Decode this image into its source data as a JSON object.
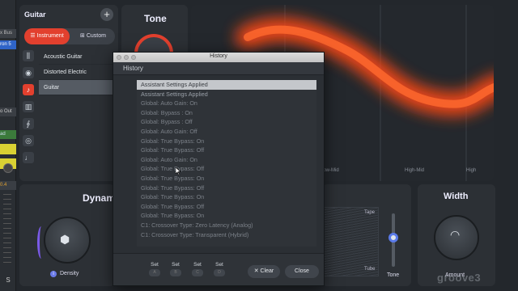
{
  "host": {
    "tags": [
      "x Bus",
      "ron 5",
      "o Out",
      "ad",
      "0.4",
      "S"
    ]
  },
  "browser": {
    "title": "Guitar",
    "add_label": "+",
    "tabs": {
      "instrument": "Instrument",
      "custom": "Custom"
    },
    "items": [
      {
        "label": "Acoustic Guitar"
      },
      {
        "label": "Distorted Electric"
      },
      {
        "label": "Guitar",
        "selected": true
      }
    ],
    "category_icons": [
      "mixer-icon",
      "speaker-icon",
      "guitar-icon",
      "piano-icon",
      "strings-icon",
      "drum-icon",
      "bass-icon"
    ]
  },
  "tone": {
    "title": "Tone"
  },
  "spectrum": {
    "bands": [
      "Low-Mid",
      "High-Mid",
      "High"
    ],
    "curve_color": "#ff4a12"
  },
  "dynamics": {
    "title": "Dynam",
    "knob_label": "Density"
  },
  "tape_tube": {
    "tape_label": "Tape",
    "tube_label": "Tube",
    "slider_label": "Tone"
  },
  "width": {
    "title": "Width",
    "knob_label": "Amount"
  },
  "watermark": "groove3",
  "history": {
    "window_title": "History",
    "header": "History",
    "items": [
      "Assistant Settings Applied",
      "Assistant Settings Applied",
      "Global: Auto Gain: On",
      "Global: Bypass : On",
      "Global: Bypass : Off",
      "Global: Auto Gain: Off",
      "Global: True Bypass: On",
      "Global: True Bypass: Off",
      "Global: Auto Gain: On",
      "Global: True Bypass: Off",
      "Global: True Bypass: On",
      "Global: True Bypass: Off",
      "Global: True Bypass: On",
      "Global: True Bypass: Off",
      "Global: True Bypass: On",
      "C1: Crossover Type: Zero Latency (Analog)",
      "C1: Crossover Type: Transparent (Hybrid)"
    ],
    "selected_index": 0,
    "set_buttons": [
      {
        "label": "Set",
        "slot": "A"
      },
      {
        "label": "Set",
        "slot": "B"
      },
      {
        "label": "Set",
        "slot": "C"
      },
      {
        "label": "Set",
        "slot": "D"
      }
    ],
    "clear_label": "Clear",
    "close_label": "Close"
  }
}
